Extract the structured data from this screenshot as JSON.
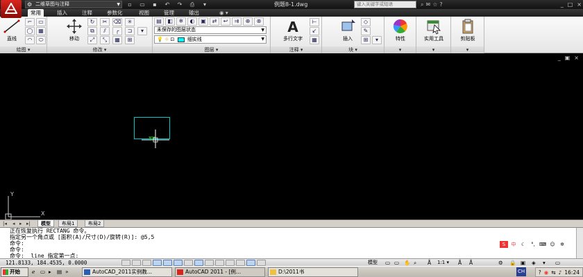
{
  "titlebar": {
    "workspace": "二维草图与注释",
    "document_title": "例题8-1.dwg",
    "search_placeholder": "键入关键字或短语",
    "window_controls": [
      "_",
      "□",
      "×"
    ]
  },
  "ribbon_tabs": [
    "常用",
    "插入",
    "注释",
    "参数化",
    "视图",
    "管理",
    "输出"
  ],
  "ribbon": {
    "draw": {
      "line_label": "直线",
      "panel_title": "绘图"
    },
    "modify": {
      "move_label": "移动",
      "panel_title": "修改"
    },
    "layers": {
      "layer_state": "未保存的图层状态",
      "current_layer": "细实线",
      "panel_title": "图层"
    },
    "annotation": {
      "mtext_label": "多行文字",
      "panel_title": "注释"
    },
    "block": {
      "insert_label": "插入",
      "panel_title": "块"
    },
    "properties": {
      "label": "特性"
    },
    "utilities": {
      "label": "实用工具"
    },
    "clipboard": {
      "label": "剪贴板"
    }
  },
  "drawing": {
    "ucs_x": "X",
    "ucs_y": "Y",
    "controls": [
      "_",
      "▣",
      "×"
    ],
    "colors": {
      "background": "#000000",
      "rectangle": "#00c8c8",
      "crosshair": "#ffffff",
      "marker": "#22cc22"
    }
  },
  "layout_tabs": [
    "模型",
    "布局1",
    "布局2"
  ],
  "command_lines": [
    "正在恢复执行 RECTANG 命令。",
    "指定另一个角点或 [面积(A)/尺寸(D)/旋转(R)]: @5,5",
    "命令:",
    "命令:",
    "命令: _line 指定第一点:"
  ],
  "status": {
    "coordinates": "121.8133, 184.4535, 0.0000",
    "model_label": "模型",
    "scale_label": "1:1"
  },
  "taskbar": {
    "start_label": "开始",
    "items": [
      "AutoCAD_2011实例教...",
      "AutoCAD 2011 - [例...",
      "D:\\2011书"
    ],
    "tray_lang": "CH",
    "clock": "16:24"
  }
}
